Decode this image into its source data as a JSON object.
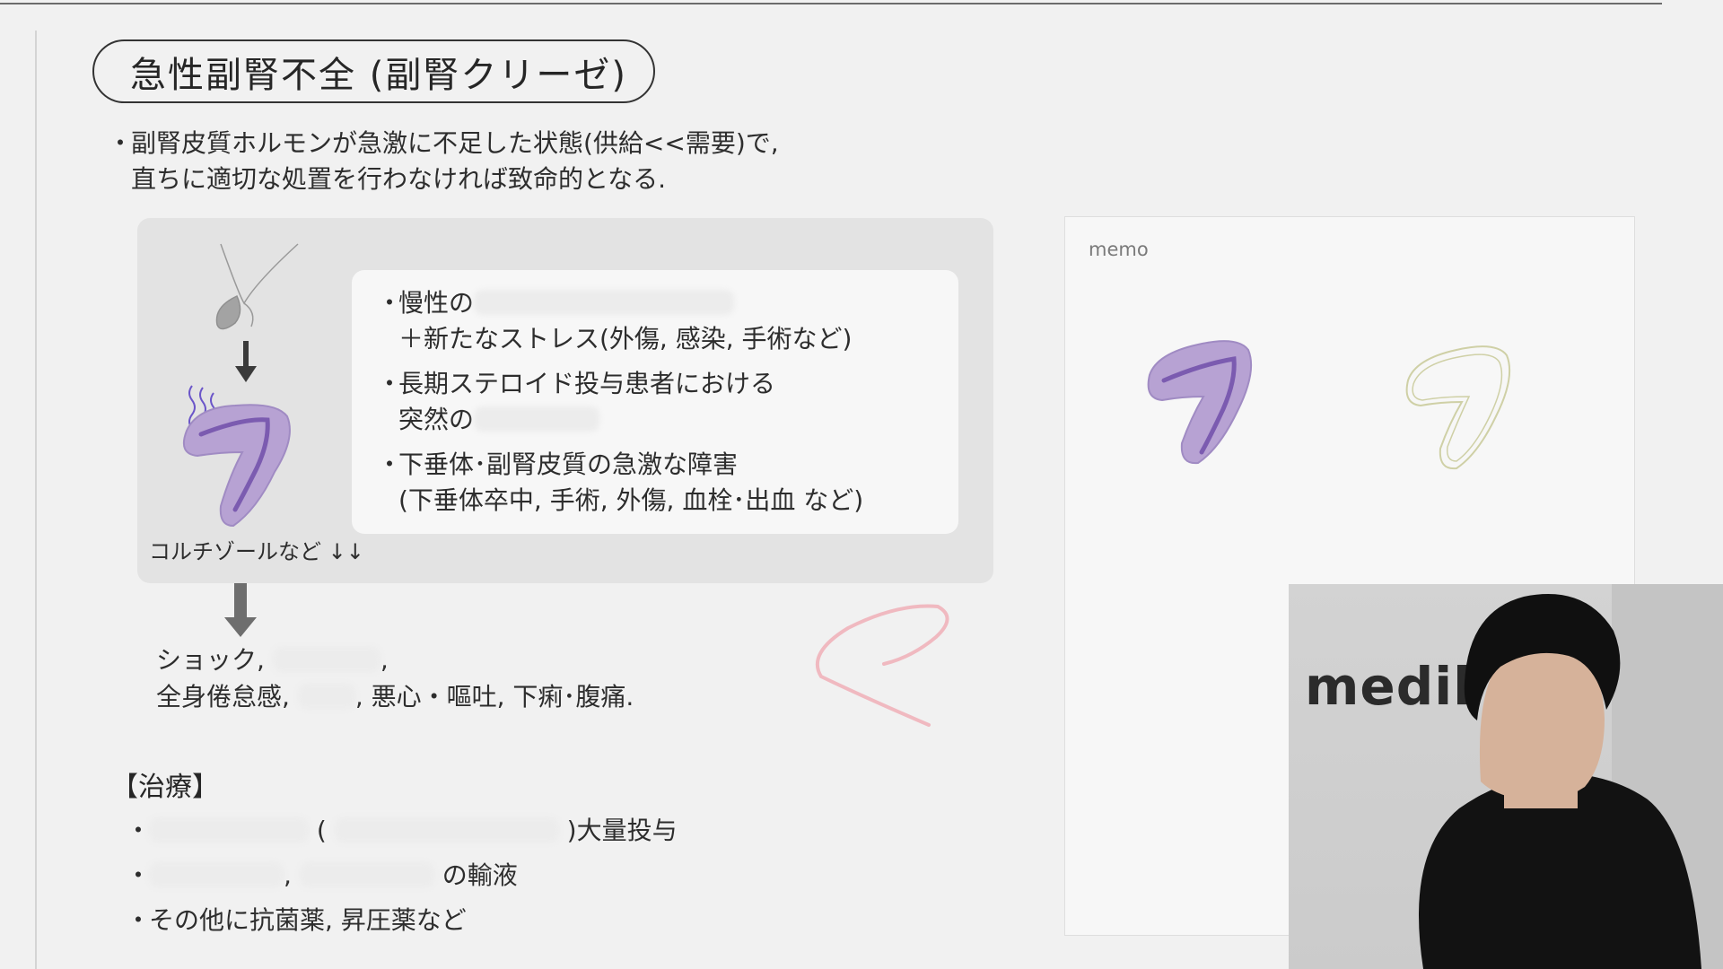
{
  "title": "急性副腎不全 (副腎クリーゼ)",
  "intro": {
    "bullet": "・",
    "line1": "副腎皮質ホルモンが急激に不足した状態(供給<<需要)で,",
    "line2": "直ちに適切な処置を行わなければ致命的となる."
  },
  "causes": [
    {
      "line1": "慢性の",
      "line2": "＋新たなストレス(外傷, 感染, 手術など)"
    },
    {
      "line1": "長期ステロイド投与患者における",
      "line2": "突然の"
    },
    {
      "line1": "下垂体･副腎皮質の急激な障害",
      "line2": "(下垂体卒中, 手術, 外傷, 血栓･出血 など)"
    }
  ],
  "bullet_char": "・",
  "cortisol_label": "コルチゾールなど ↓↓",
  "symptoms": {
    "line1_prefix": "ショック,",
    "line1_suffix": ",",
    "line2_prefix": "全身倦怠感,",
    "line2_suffix": ", 悪心・嘔吐, 下痢･腹痛."
  },
  "treatment": {
    "heading": "【治療】",
    "item1_open": "(",
    "item1_suffix": ")大量投与",
    "item2_mid": ",",
    "item2_suffix": "の輸液",
    "item3": "その他に抗菌薬, 昇圧薬など"
  },
  "memo": {
    "label": "memo"
  },
  "webcam": {
    "brand": "medil"
  },
  "colors": {
    "background": "#f1f1f1",
    "panel": "#e3e3e3",
    "card": "#f7f7f7",
    "gland_fill": "#b7a2d3",
    "gland_stroke": "#7b5bb0",
    "scribble": "#f0b9c0",
    "outline_gland": "#cfd0a6"
  },
  "icons": [
    "pituitary-icon",
    "down-arrow-icon",
    "adrenal-gland-icon",
    "heat-wave-icon",
    "pink-scribble-icon",
    "adrenal-outline-icon"
  ]
}
